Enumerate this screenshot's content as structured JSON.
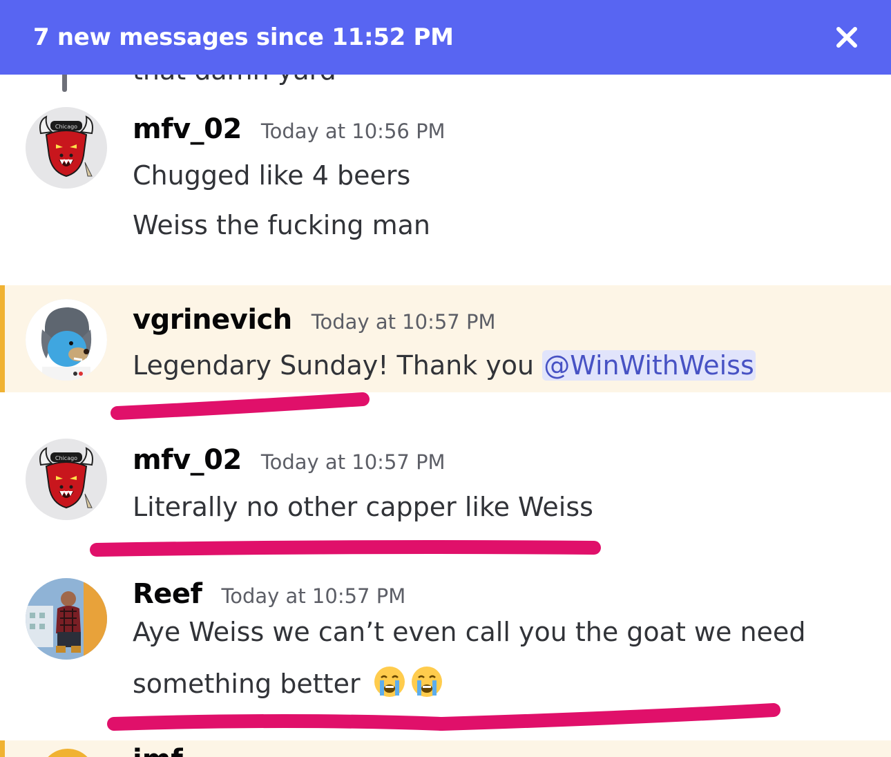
{
  "banner": {
    "text": "7 new messages since 11:52 PM",
    "background": "#5865f2",
    "close_icon": "close-icon"
  },
  "previous_message": {
    "text": "that damn yard"
  },
  "messages": [
    {
      "username": "mfv_02",
      "timestamp": "Today at 10:56 PM",
      "avatar": "bull-avatar",
      "lines": [
        "Chugged like 4 beers",
        "Weiss the fucking man"
      ]
    },
    {
      "username": "vgrinevich",
      "timestamp": "Today at 10:57 PM",
      "avatar": "bear-avatar",
      "mention_highlight": true,
      "text_before_mention": "Legendary Sunday! Thank you ",
      "mention": "@WinWithWeiss"
    },
    {
      "username": "mfv_02",
      "timestamp": "Today at 10:57 PM",
      "avatar": "bull-avatar",
      "lines": [
        "Literally no other capper like Weiss"
      ]
    },
    {
      "username": "Reef",
      "timestamp": "Today at 10:57 PM",
      "avatar": "photo-avatar",
      "lines": [
        "Aye Weiss we can’t even call you the goat we need",
        "something better"
      ],
      "emojis": [
        "crying-face-emoji",
        "crying-face-emoji"
      ]
    }
  ],
  "next_message": {
    "username_partial": "jmf"
  },
  "colors": {
    "accent": "#5865f2",
    "mention_bg": "#fdf5e6",
    "mention_bar": "#f0b232",
    "mention_tag_bg": "#e1e4fb",
    "mention_tag_text": "#4752c4",
    "highlighter": "#e0106a"
  }
}
